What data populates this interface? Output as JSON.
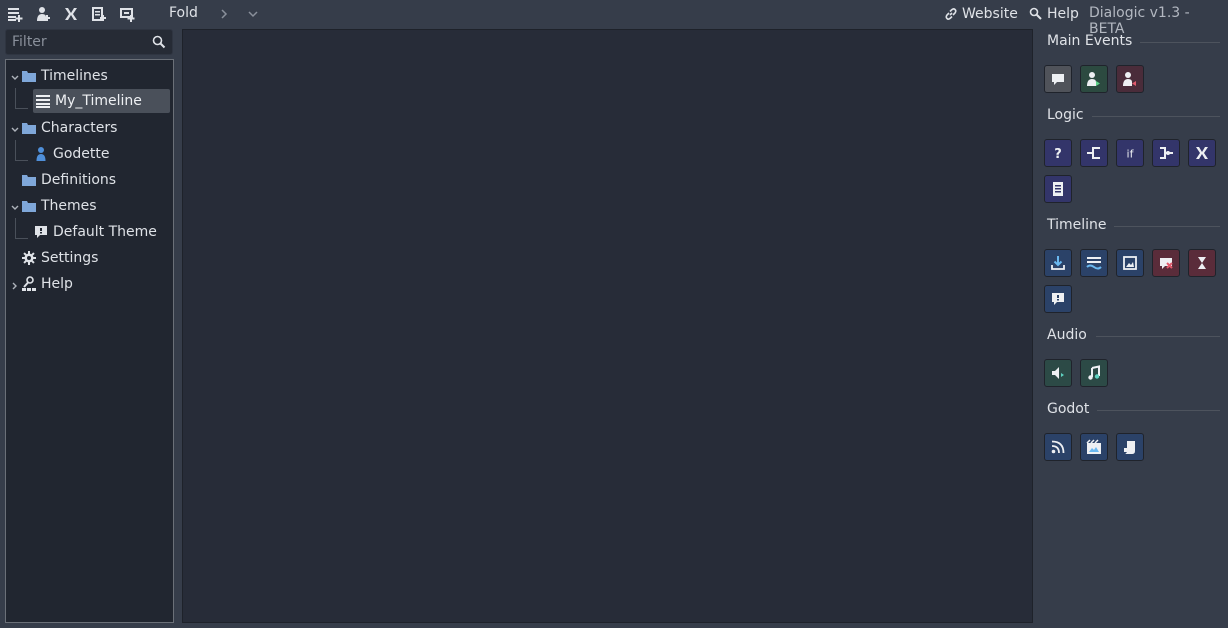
{
  "toolbar": {
    "icons": [
      "new-timeline-icon",
      "new-character-icon",
      "new-definition-icon",
      "new-theme-icon",
      "add-glossary-icon"
    ],
    "fold_label": "Fold",
    "website_label": "Website",
    "help_label": "Help",
    "version": "Dialogic v1.3 - BETA"
  },
  "sidebar": {
    "filter_placeholder": "Filter",
    "tree": {
      "timelines": "Timelines",
      "my_timeline": "My_Timeline",
      "characters": "Characters",
      "godette": "Godette",
      "definitions": "Definitions",
      "themes": "Themes",
      "default_theme": "Default Theme",
      "settings": "Settings",
      "help": "Help"
    }
  },
  "events_panel": {
    "sections": {
      "main_events": "Main Events",
      "logic": "Logic",
      "timeline": "Timeline",
      "audio": "Audio",
      "godot": "Godot"
    },
    "colors": {
      "main_text": "#50535a",
      "character_join": "#2c4a40",
      "character_leave": "#4a2c3a",
      "logic": "#33356a",
      "timeline_blue": "#2b4268",
      "timeline_red": "#5a2c3a",
      "audio": "#2c4a46",
      "godot": "#2b4268"
    }
  }
}
